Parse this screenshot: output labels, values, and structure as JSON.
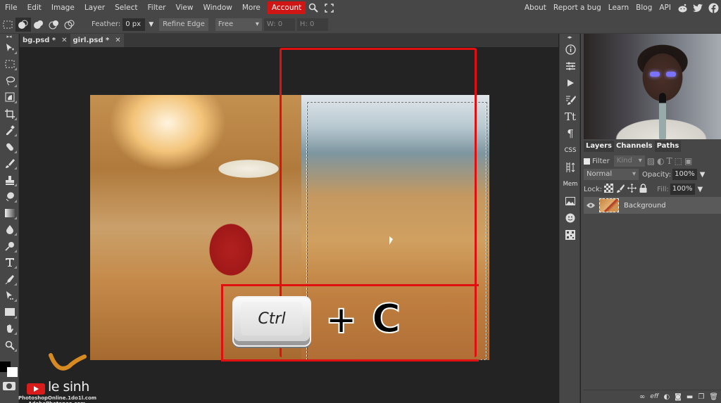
{
  "menubar": {
    "items": [
      "File",
      "Edit",
      "Image",
      "Layer",
      "Select",
      "Filter",
      "View",
      "Window",
      "More"
    ],
    "account": "Account",
    "icons": [
      "search-icon",
      "fullscreen-icon"
    ],
    "right_links": [
      "About",
      "Report a bug",
      "Learn",
      "Blog",
      "API"
    ],
    "social_icons": [
      "reddit-icon",
      "twitter-icon",
      "facebook-icon"
    ]
  },
  "options": {
    "feather_label": "Feather:",
    "feather_value": "0 px",
    "refine_edge": "Refine Edge",
    "style_value": "Free",
    "w_label": "W:",
    "w_value": "0",
    "h_label": "H:",
    "h_value": "0"
  },
  "tabs": [
    {
      "label": "bg.psd *",
      "active": false
    },
    {
      "label": "girl.psd *",
      "active": true
    }
  ],
  "tools": [
    "move",
    "marquee",
    "lasso",
    "quick-select",
    "crop",
    "eyedropper",
    "healing",
    "brush",
    "stamp",
    "eraser",
    "gradient",
    "blur",
    "dodge",
    "type",
    "pen",
    "path-select",
    "shape",
    "hand",
    "zoom"
  ],
  "overlay": {
    "ctrl_key": "Ctrl",
    "plus": "+",
    "c_key": "C"
  },
  "watermark": {
    "name": "le sinh",
    "url1": "PhotoshopOnline.1do1l.com",
    "url2": "AdobePhotopea.com"
  },
  "iconcol": {
    "css": "CSS",
    "mem": "Mem"
  },
  "panel": {
    "tabs": [
      "Layers",
      "Channels",
      "Paths"
    ],
    "filter_label": "Filter",
    "kind_value": "Kind",
    "blend_mode": "Normal",
    "opacity_label": "Opacity:",
    "opacity_value": "100%",
    "lock_label": "Lock:",
    "fill_label": "Fill:",
    "fill_value": "100%",
    "layers": [
      {
        "name": "Background",
        "visible": true
      }
    ],
    "bottom_icons": [
      "link-icon",
      "effects-icon",
      "adjustment-icon",
      "mask-icon",
      "folder-icon",
      "new-layer-icon",
      "trash-icon"
    ]
  },
  "colors": {
    "accent": "#d01515",
    "annotation": "#e01010",
    "foreground": "#000000",
    "background": "#ffffff"
  }
}
